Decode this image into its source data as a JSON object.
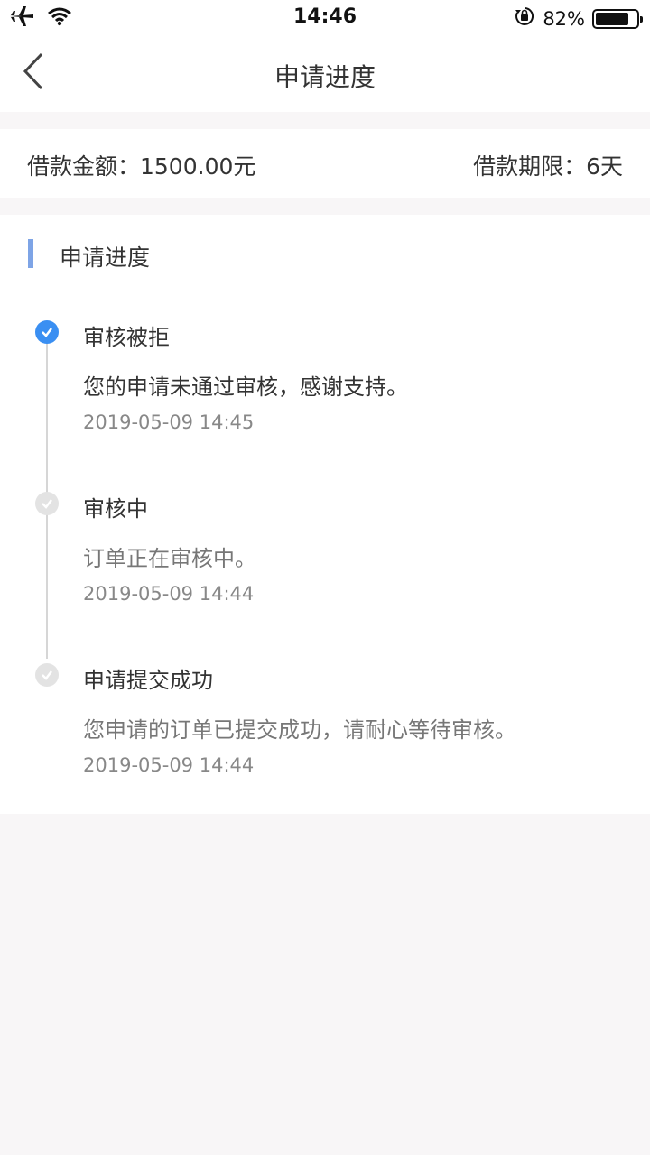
{
  "status_bar": {
    "time": "14:46",
    "battery_percent": "82%",
    "battery_level": 0.82,
    "icons": [
      "airplane-icon",
      "wifi-icon",
      "orientation-lock-icon",
      "battery-icon"
    ]
  },
  "nav": {
    "title": "申请进度",
    "back_icon": "chevron-left-icon"
  },
  "loan": {
    "amount": "借款金额：1500.00元",
    "term": "借款期限：6天"
  },
  "progress": {
    "section_title": "申请进度",
    "accent_color": "#7ea4e6",
    "active_color": "#3a8ff2",
    "steps": [
      {
        "title": "审核被拒",
        "desc": "您的申请未通过审核，感谢支持。",
        "time": "2019-05-09 14:45",
        "active": true
      },
      {
        "title": "审核中",
        "desc": "订单正在审核中。",
        "time": "2019-05-09 14:44",
        "active": false
      },
      {
        "title": "申请提交成功",
        "desc": "您申请的订单已提交成功，请耐心等待审核。",
        "time": "2019-05-09 14:44",
        "active": false
      }
    ]
  }
}
